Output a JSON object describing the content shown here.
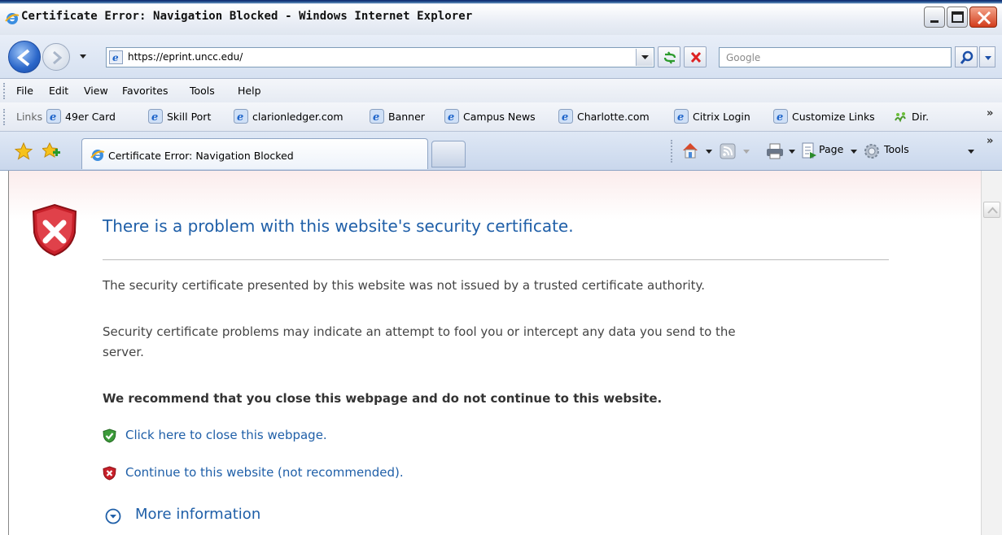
{
  "window": {
    "title": "Certificate Error: Navigation Blocked - Windows Internet Explorer"
  },
  "address_bar": {
    "url": "https://eprint.uncc.edu/",
    "search_placeholder": "Google"
  },
  "menu": {
    "items": [
      "File",
      "Edit",
      "View",
      "Favorites",
      "Tools",
      "Help"
    ]
  },
  "links_bar": {
    "label": "Links",
    "items": [
      "49er Card",
      "Skill Port",
      "clarionledger.com",
      "Banner",
      "Campus News",
      "Charlotte.com",
      "Citrix Login",
      "Customize Links"
    ],
    "dir_label": "Dir."
  },
  "tabs": {
    "active_label": "Certificate Error: Navigation Blocked"
  },
  "command_bar": {
    "page_label": "Page",
    "tools_label": "Tools"
  },
  "content": {
    "heading": "There is a problem with this website's security certificate.",
    "para1": "The security certificate presented by this website was not issued by a trusted certificate authority.",
    "para2_line1": "Security certificate problems may indicate an attempt to fool you or intercept any data you send to the",
    "para2_line2": "server.",
    "recommend": "We recommend that you close this webpage and do not continue to this website.",
    "close_link": "Click here to close this webpage.",
    "continue_link": "Continue to this website (not recommended).",
    "more_info": "More information"
  },
  "colors": {
    "link_blue": "#1f5fa8",
    "shield_red": "#c8202a",
    "ok_green": "#3c9b3a"
  }
}
